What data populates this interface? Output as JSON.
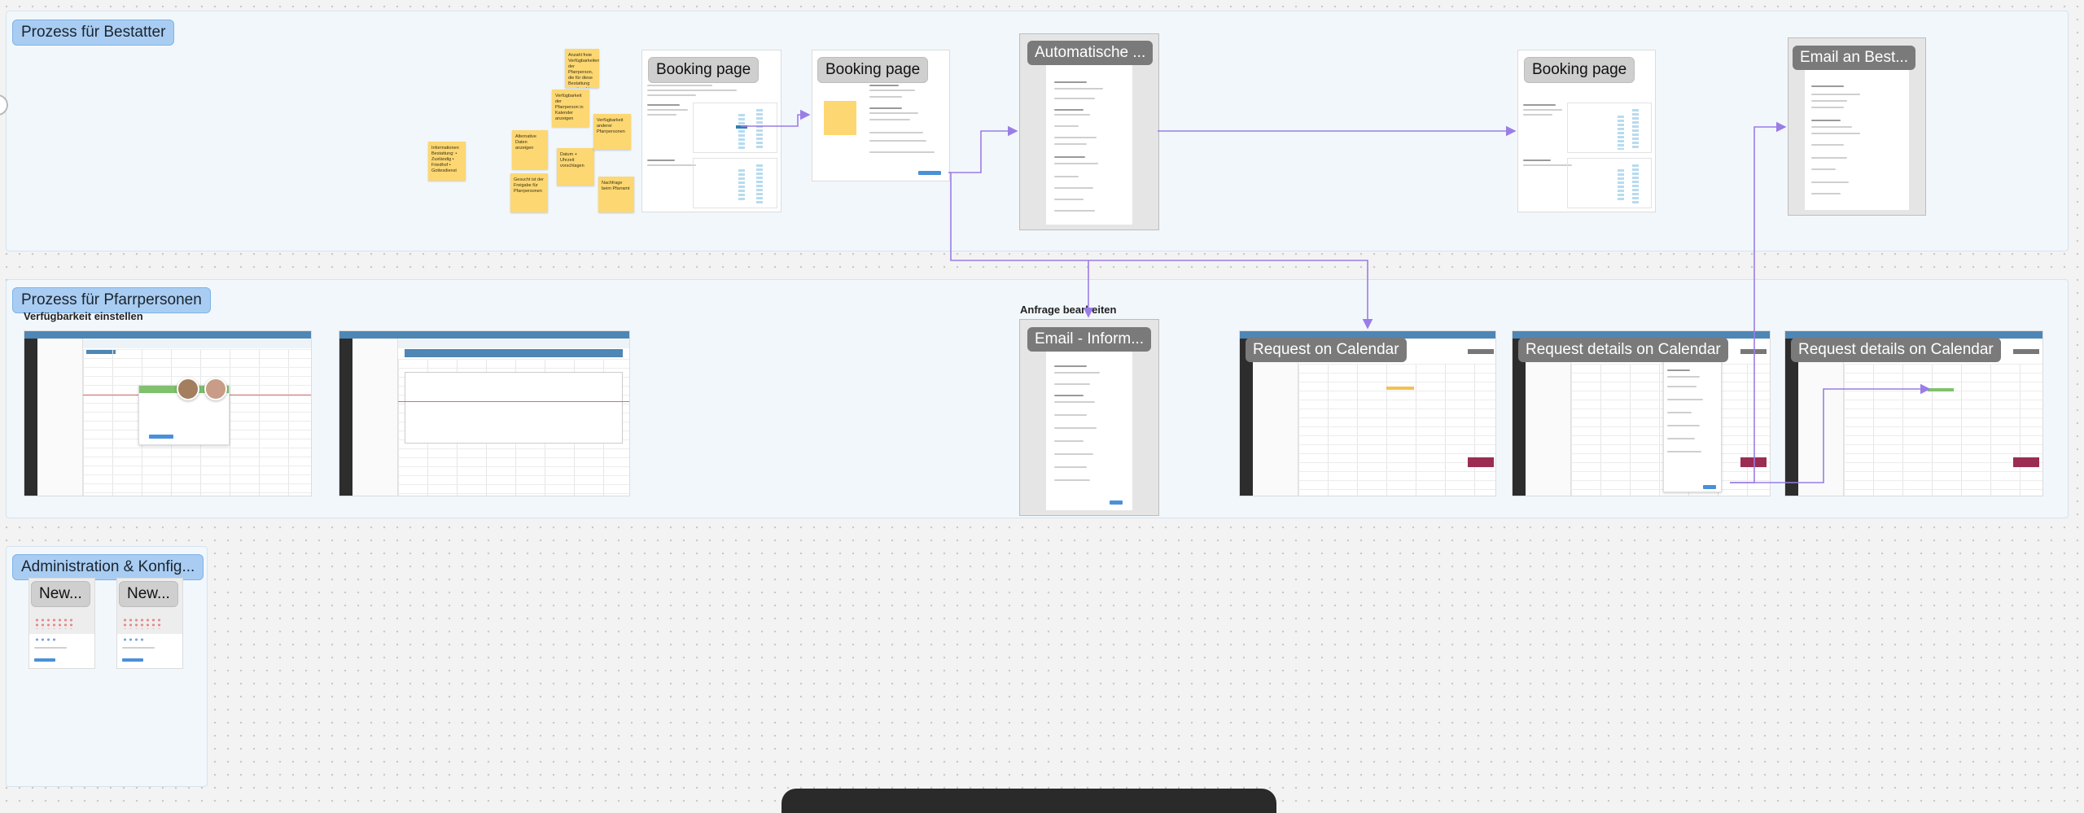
{
  "sections": {
    "bestatter": {
      "label": "Prozess für Bestatter"
    },
    "pfarr": {
      "label": "Prozess für Pfarrpersonen",
      "sub_label": "Verfügbarkeit einstellen"
    },
    "admin": {
      "label": "Administration & Konfig..."
    }
  },
  "frame_titles": {
    "anfrage": "Anfrage bearbeiten"
  },
  "screens": {
    "booking1": {
      "title": "Booking page"
    },
    "booking2": {
      "title": "Booking page"
    },
    "automatische": {
      "title": "Automatische ..."
    },
    "booking3": {
      "title": "Booking page"
    },
    "email_best": {
      "title": "Email an Best..."
    },
    "email_inform": {
      "title": "Email - Inform..."
    },
    "request_cal": {
      "title": "Request on Calendar"
    },
    "request_details1": {
      "title": "Request details on Calendar"
    },
    "request_details2": {
      "title": "Request details on Calendar"
    },
    "new1": {
      "title": "New..."
    },
    "new2": {
      "title": "New..."
    }
  },
  "stickies": [
    {
      "text": "Informationen Bestattung: • Zuständig • Friedhof • Gottesdienst"
    },
    {
      "text": "Anzahl freie Verfügbarkeiten der Pfarrperson, die für diese Bestattung gewünscht werden"
    },
    {
      "text": "Verfügbarkeit der Pfarrperson in Kalender anzeigen"
    },
    {
      "text": "Alternative Daten anzeigen"
    },
    {
      "text": "Gesucht ist der Freigabe für Pfarrpersonen"
    },
    {
      "text": "Datum + Uhrzeit vorschlagen"
    },
    {
      "text": "Verfügbarkeit anderer Pfarrpersonen"
    },
    {
      "text": "Nachfrage beim Pfarramt"
    }
  ],
  "colors": {
    "section_bg": "#f2f7fc",
    "label_bg": "#a9cdf2",
    "sticky": "#fcd772",
    "pill_dark": "#7a7a7a",
    "connector": "#9a7de6",
    "calendar_header": "#4e86b5"
  }
}
